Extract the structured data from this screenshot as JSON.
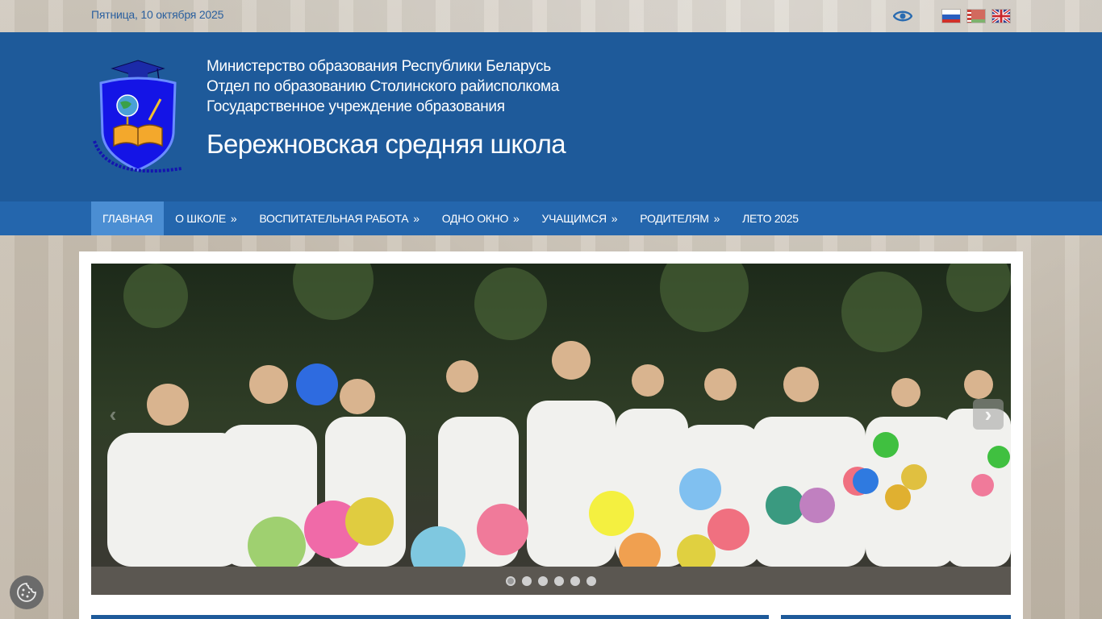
{
  "topbar": {
    "date": "Пятница, 10 октября 2025",
    "accessibility_icon": "eye-icon",
    "languages": [
      "ru",
      "by",
      "en"
    ]
  },
  "header": {
    "line1": "Министерство образования Республики Беларусь",
    "line2": "Отдел по образованию Столинского райисполкома",
    "line3": "Государственное учреждение образования",
    "school_name": "Бережновская средняя школа",
    "logo_text": "Бережновская средняя школа"
  },
  "nav": {
    "items": [
      {
        "label": "Главная",
        "arrow": ""
      },
      {
        "label": "О школе",
        "arrow": "»"
      },
      {
        "label": "Воспитательная работа",
        "arrow": "»"
      },
      {
        "label": "Одно окно",
        "arrow": "»"
      },
      {
        "label": "Учащимся",
        "arrow": "»"
      },
      {
        "label": "Родителям",
        "arrow": "»"
      },
      {
        "label": "Лето 2025",
        "arrow": ""
      }
    ]
  },
  "slider": {
    "prev_icon": "chevron-left-icon",
    "next_icon": "chevron-right-icon",
    "slide_count": 6,
    "active_slide": 1
  },
  "colors": {
    "header_bg": "#1e5a9a",
    "nav_bg": "#2466ad",
    "nav_active": "#4b8ed3",
    "date_text": "#2a5f9e"
  }
}
